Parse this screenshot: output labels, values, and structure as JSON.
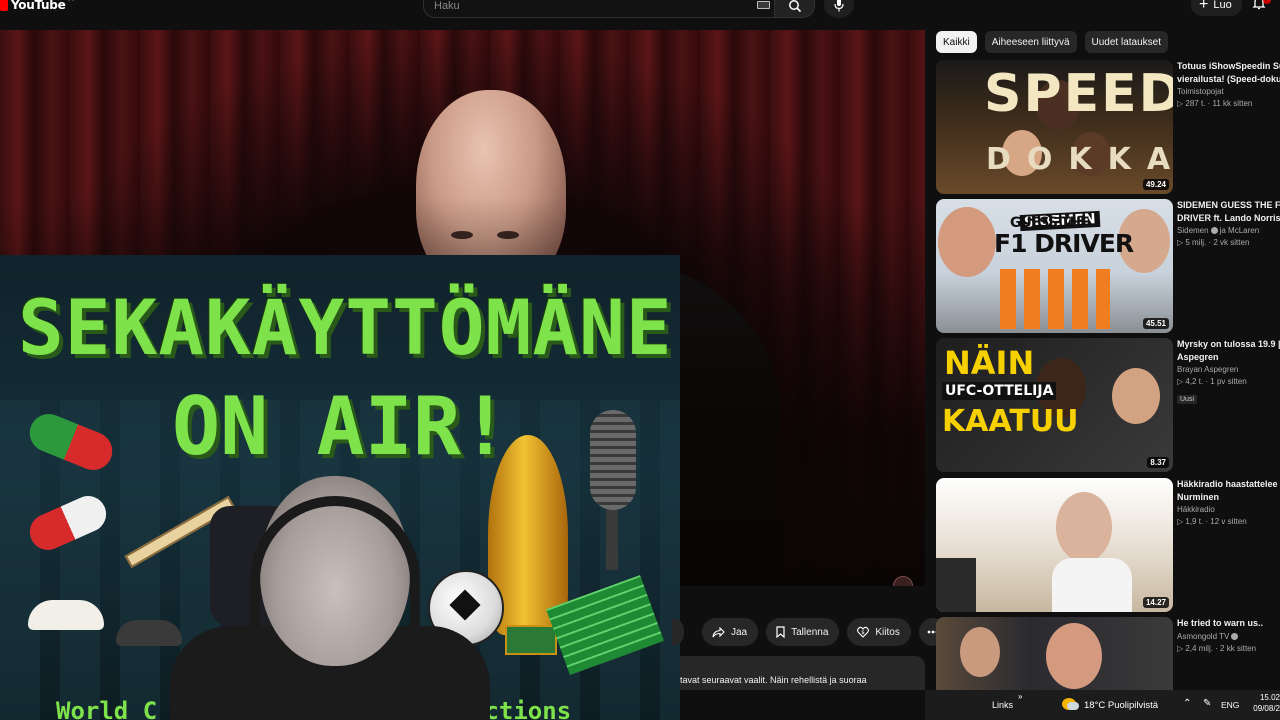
{
  "topbar": {
    "logo_text": "YouTube",
    "logo_region": "FI",
    "search_placeholder": "Haku",
    "create_label": "Luo"
  },
  "overlay": {
    "line1": "SEKAKÄYTTÖMÄNE",
    "line2": "ON AIR!",
    "bottom_left": "World C",
    "bottom_right": "actions"
  },
  "actions": {
    "share": "Jaa",
    "save": "Tallenna",
    "thanks": "Kiitos"
  },
  "description": "tavat seuraavat vaalit. Näin rehellistä ja suoraa",
  "chips": [
    "Kaikki",
    "Aiheeseen liittyvä",
    "Uudet lataukset"
  ],
  "recommendations": [
    {
      "title1": "Totuus iShowSpeedin Su",
      "title2": "vierailusta! (Speed-doku",
      "channel": "Toimistopojat",
      "stats": "287 t. · 11 kk sitten",
      "duration": "49.24",
      "thumb_text": "SPEED",
      "thumb_text2": "DOKKARI"
    },
    {
      "title1": "SIDEMEN GUESS THE F1",
      "title2": "DRIVER ft. Lando Norris",
      "channel": "Sidemen",
      "channel_suffix": "ja McLaren",
      "stats": "5 milj. · 2 vk sitten",
      "duration": "45.51",
      "thumb_brand": "SIDEMEN",
      "thumb_text": "GUESS THE",
      "thumb_text2": "F1 DRIVER"
    },
    {
      "title1": "Myrsky on tulossa 19.9 |",
      "title2": "Aspegren",
      "channel": "Brayan Aspegren",
      "stats": "4,2 t. · 1 pv sitten",
      "badge": "Uusi",
      "duration": "8.37",
      "thumb_text": "NÄIN",
      "thumb_text2": "UFC-OTTELIJA",
      "thumb_text3": "KAATUU"
    },
    {
      "title1": "Häkkiradio haastattelee",
      "title2": "Nurminen",
      "channel": "Häkkiradio",
      "stats": "1,9 t. · 12 v sitten",
      "duration": "14.27"
    },
    {
      "title1": "He tried to warn us..",
      "channel": "Asmongold TV",
      "stats": "2,4 milj. · 2 kk sitten"
    }
  ],
  "taskbar": {
    "links": "Links",
    "chevron": "»",
    "weather": "18°C  Puolipilvistä",
    "lang": "ENG",
    "time": "15.02",
    "date": "09/08/2"
  },
  "colors": {
    "bg": "#0f0f0f",
    "chip_bg": "#272727",
    "brand_red": "#ff0000",
    "overlay_green": "#7ee24a"
  }
}
